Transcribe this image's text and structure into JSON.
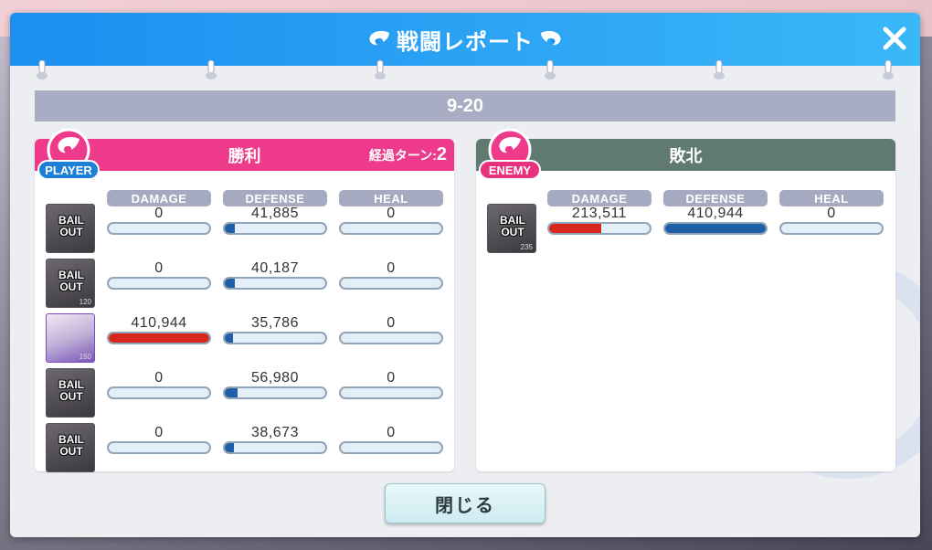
{
  "dialog": {
    "title": "戦闘レポート",
    "close_icon": "close-icon",
    "stage": "9-20",
    "close_button_label": "閉じる"
  },
  "player": {
    "badge": "PLAYER",
    "result": "勝利",
    "turns_label": "経過ターン:",
    "turns_value": "2",
    "columns": [
      "DAMAGE",
      "DEFENSE",
      "HEAL"
    ],
    "units": [
      {
        "avatar_text": "BAIL OUT",
        "status": "bail-out",
        "damage": "0",
        "defense": "41,885",
        "heal": "0",
        "damage_ratio": 0,
        "defense_ratio": 0.1,
        "heal_ratio": 0
      },
      {
        "avatar_text": "BAIL OUT",
        "level": "120",
        "status": "bail-out",
        "damage": "0",
        "defense": "40,187",
        "heal": "0",
        "damage_ratio": 0,
        "defense_ratio": 0.1,
        "heal_ratio": 0
      },
      {
        "avatar_text": "",
        "level": "150",
        "status": "alive",
        "damage": "410,944",
        "defense": "35,786",
        "heal": "0",
        "damage_ratio": 1.0,
        "defense_ratio": 0.08,
        "heal_ratio": 0
      },
      {
        "avatar_text": "BAIL OUT",
        "status": "bail-out",
        "damage": "0",
        "defense": "56,980",
        "heal": "0",
        "damage_ratio": 0,
        "defense_ratio": 0.13,
        "heal_ratio": 0
      },
      {
        "avatar_text": "BAIL OUT",
        "status": "bail-out",
        "damage": "0",
        "defense": "38,673",
        "heal": "0",
        "damage_ratio": 0,
        "defense_ratio": 0.09,
        "heal_ratio": 0
      }
    ]
  },
  "enemy": {
    "badge": "ENEMY",
    "result": "敗北",
    "columns": [
      "DAMAGE",
      "DEFENSE",
      "HEAL"
    ],
    "units": [
      {
        "avatar_text": "BAIL OUT",
        "level": "235",
        "status": "bail-out",
        "damage": "213,511",
        "defense": "410,944",
        "heal": "0",
        "damage_ratio": 0.52,
        "defense_ratio": 1.0,
        "heal_ratio": 0
      }
    ]
  },
  "colors": {
    "header": "#1c8ff0",
    "player_accent": "#ee3a8a",
    "enemy_accent": "#607a72",
    "damage_bar": "#d9261c",
    "defense_bar": "#1f5fa8"
  }
}
